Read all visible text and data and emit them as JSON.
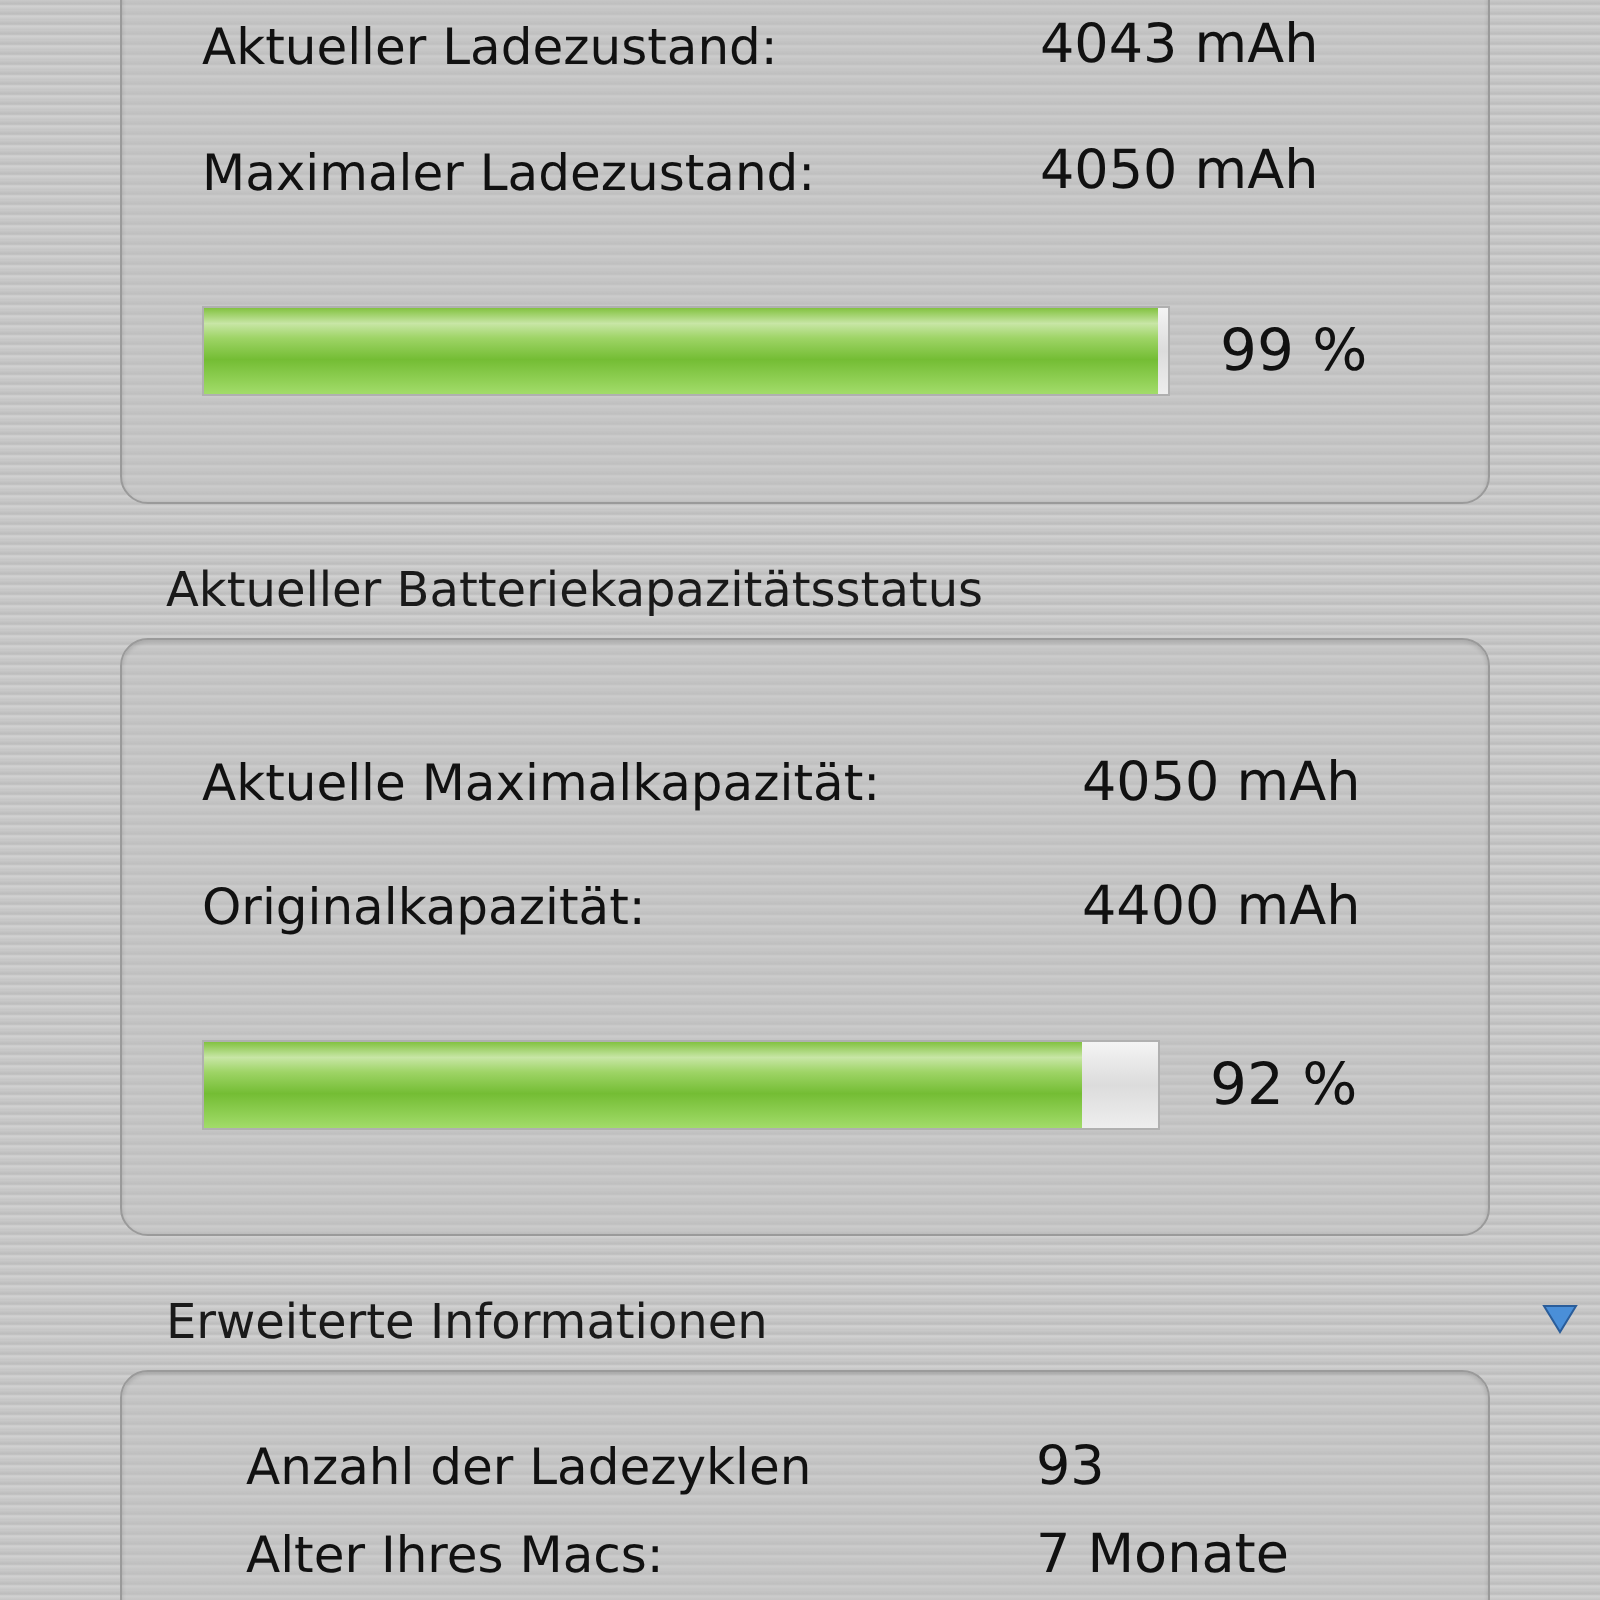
{
  "sections": [
    {
      "rows": [
        {
          "label": "Aktueller Ladezustand:",
          "value": "4043 mAh"
        },
        {
          "label": "Maximaler Ladezustand:",
          "value": "4050 mAh"
        }
      ],
      "bar": {
        "level": 0.99,
        "reading": "99 %"
      }
    },
    {
      "title": "Aktueller Batteriekapazitätsstatus",
      "rows": [
        {
          "label": "Aktuelle Maximalkapazität:",
          "value": "4050 mAh"
        },
        {
          "label": "Originalkapazität:",
          "value": "4400 mAh"
        }
      ],
      "bar": {
        "level": 0.92,
        "reading": "92 %"
      }
    },
    {
      "title": "Erweiterte Informationen",
      "expanded": true,
      "rows": [
        {
          "label": "Anzahl der Ladezyklen",
          "value": "93"
        },
        {
          "label": "Alter Ihres Macs:",
          "value": "7 Monate"
        }
      ]
    }
  ]
}
